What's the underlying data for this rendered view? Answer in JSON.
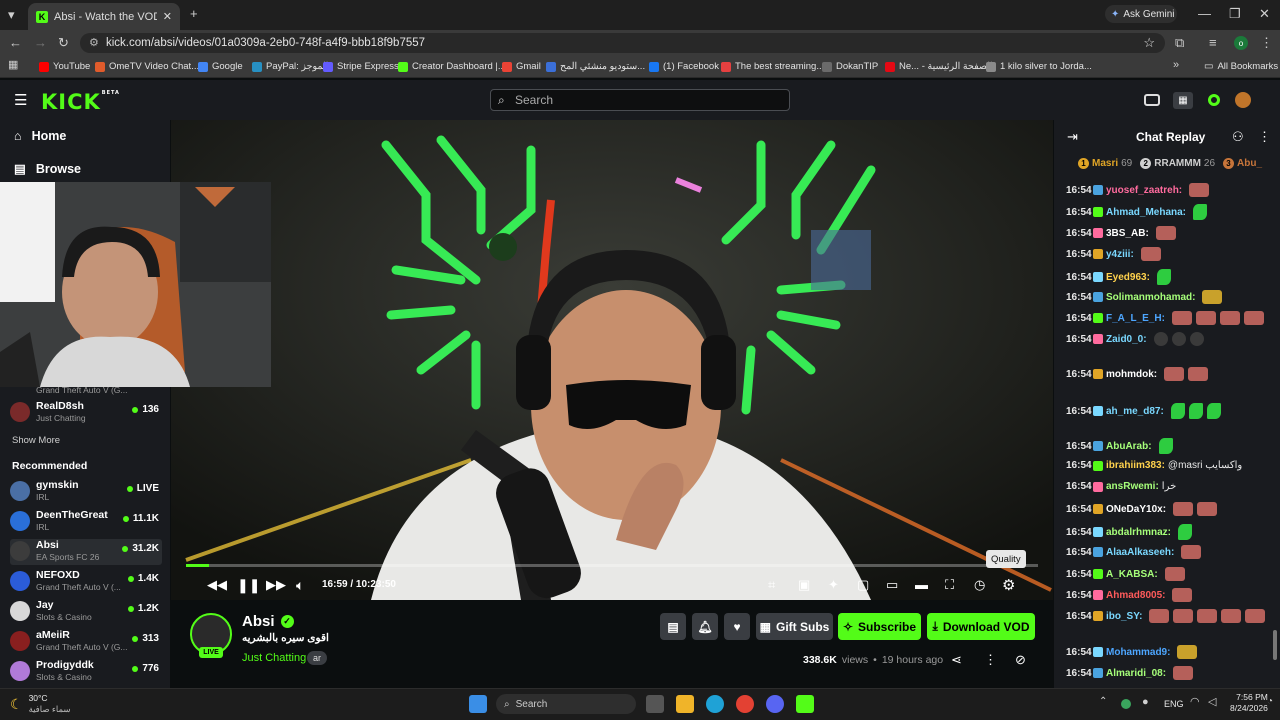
{
  "browser": {
    "tab_title": "Absi - Watch the VOD on K",
    "ask_gemini": "Ask Gemini",
    "url": "kick.com/absi/videos/01a0309a-2eb0-748f-a4f9-bbb18f9b7557",
    "bookmarks": [
      {
        "label": "YouTube",
        "color": "#ff0000"
      },
      {
        "label": "OmeTV Video Chat...",
        "color": "#e05b2b"
      },
      {
        "label": "Google",
        "color": "#4285f4"
      },
      {
        "label": "PayPal: الموجز",
        "color": "#2790c3"
      },
      {
        "label": "Stripe Express",
        "color": "#635bff"
      },
      {
        "label": "Creator Dashboard |...",
        "color": "#53fc18"
      },
      {
        "label": "Gmail",
        "color": "#ea4335"
      },
      {
        "label": "ستوديو منشئي المح...",
        "color": "#3b6fd8"
      },
      {
        "label": "(1) Facebook",
        "color": "#1877f2"
      },
      {
        "label": "The best streaming...",
        "color": "#e54040"
      },
      {
        "label": "DokanTIP",
        "color": "#6a6a6a"
      },
      {
        "label": "Ne... - الصفحة الرئيسية",
        "color": "#e50914"
      },
      {
        "label": "1 kilo silver to Jorda...",
        "color": "#8a8a8a"
      }
    ],
    "all_bookmarks": "All Bookmarks"
  },
  "kick": {
    "logo": "KICK",
    "logo_badge": "BETA",
    "search_placeholder": "Search",
    "nav": [
      {
        "label": "Home",
        "icon": "home-icon"
      },
      {
        "label": "Browse",
        "icon": "browse-icon"
      }
    ],
    "followed_partial": {
      "category": "Grand Theft Auto V (G..."
    },
    "followed": [
      {
        "name": "RealD8sh",
        "category": "Just Chatting",
        "viewers": "136",
        "color": "#7a2a2a"
      }
    ],
    "show_more": "Show More",
    "recommended_title": "Recommended",
    "recommended": [
      {
        "name": "gymskin",
        "category": "IRL",
        "viewers": "LIVE",
        "color": "#4a6fa5"
      },
      {
        "name": "DeenTheGreat",
        "category": "IRL",
        "viewers": "11.1K",
        "color": "#2a6fd8"
      },
      {
        "name": "Absi",
        "category": "EA Sports FC 26",
        "viewers": "31.2K",
        "color": "#3c3c3c"
      },
      {
        "name": "NEFOXD",
        "category": "Grand Theft Auto V (...",
        "viewers": "1.4K",
        "color": "#2b5cd8"
      },
      {
        "name": "Jay",
        "category": "Slots & Casino",
        "viewers": "1.2K",
        "color": "#d8d8d8"
      },
      {
        "name": "aMeiiR",
        "category": "Grand Theft Auto V (G...",
        "viewers": "313",
        "color": "#8a1f1f"
      },
      {
        "name": "Prodigyddk",
        "category": "Slots & Casino",
        "viewers": "776",
        "color": "#b07ad8"
      }
    ]
  },
  "player": {
    "time": "16:59 / 10:23:50",
    "progress_fraction": 0.027,
    "tooltip": "Quality"
  },
  "channel": {
    "name": "Absi",
    "live_badge": "LIVE",
    "subtitle": "اقوى سيره بالبشريه",
    "category": "Just Chatting",
    "language": "ar",
    "gift_subs": "Gift Subs",
    "subscribe": "Subscribe",
    "download": "Download VOD",
    "views": "338.6K",
    "views_label": "views",
    "ago": "19 hours ago"
  },
  "chat": {
    "title": "Chat Replay",
    "leaders": [
      {
        "rank": "1",
        "name": "Masri",
        "count": "69"
      },
      {
        "rank": "2",
        "name": "RRAMMM",
        "count": "26"
      },
      {
        "rank": "3",
        "name": "Abu_",
        "count": ""
      }
    ],
    "messages": [
      {
        "time": "16:54",
        "user": "yuosef_zaatreh:",
        "color": "#ff6b9e",
        "text": "",
        "emotes": [
          "r"
        ]
      },
      {
        "time": "16:54",
        "user": "Ahmad_Mehana:",
        "color": "#7ad8ff",
        "text": "",
        "emotes": [
          "g"
        ]
      },
      {
        "time": "16:54",
        "user": "3BS_AB:",
        "color": "#ffffff",
        "text": "",
        "emotes": [
          "r"
        ]
      },
      {
        "time": "16:54",
        "user": "y4ziii:",
        "color": "#7ad8ff",
        "text": "",
        "emotes": [
          "r"
        ]
      },
      {
        "time": "16:54",
        "user": "Eyed963:",
        "color": "#ffd24d",
        "text": "",
        "emotes": [
          "g"
        ]
      },
      {
        "time": "16:54",
        "user": "Solimanmohamad:",
        "color": "#a6ff7a",
        "text": "",
        "emotes": [
          "y"
        ]
      },
      {
        "time": "16:54",
        "user": "F_A_L_E_H:",
        "color": "#4da6ff",
        "text": "",
        "emotes": [
          "r",
          "r",
          "r",
          "r"
        ]
      },
      {
        "time": "16:54",
        "user": "Zaid0_0:",
        "color": "#7ad8ff",
        "text": "",
        "emotes": [
          "d",
          "d",
          "d"
        ]
      },
      {
        "time": "16:54",
        "user": "mohmdok:",
        "color": "#ffffff",
        "text": "",
        "emotes": [
          "r",
          "r"
        ]
      },
      {
        "time": "16:54",
        "user": "ah_me_d87:",
        "color": "#7ad8ff",
        "text": "",
        "emotes": [
          "g",
          "g",
          "g"
        ]
      },
      {
        "time": "16:54",
        "user": "AbuArab:",
        "color": "#a6ff7a",
        "text": "",
        "emotes": [
          "g"
        ]
      },
      {
        "time": "16:54",
        "user": "ibrahiim383:",
        "color": "#ffd24d",
        "text": "@masri واكسايب",
        "emotes": []
      },
      {
        "time": "16:54",
        "user": "ansRwemi:",
        "color": "#a6ff7a",
        "text": "خرا",
        "emotes": []
      },
      {
        "time": "16:54",
        "user": "ONeDaY10x:",
        "color": "#ffffff",
        "text": "",
        "emotes": [
          "r",
          "r"
        ]
      },
      {
        "time": "16:54",
        "user": "abdalrhmnaz:",
        "color": "#a6ff7a",
        "text": "",
        "emotes": [
          "g"
        ]
      },
      {
        "time": "16:54",
        "user": "AlaaAlkaseeh:",
        "color": "#7ad8ff",
        "text": "",
        "emotes": [
          "r"
        ]
      },
      {
        "time": "16:54",
        "user": "A_KABSA:",
        "color": "#a6ff7a",
        "text": "",
        "emotes": [
          "r"
        ]
      },
      {
        "time": "16:54",
        "user": "Ahmad8005:",
        "color": "#ff5b5b",
        "text": "",
        "emotes": [
          "r"
        ]
      },
      {
        "time": "16:54",
        "user": "ibo_SY:",
        "color": "#7ad8ff",
        "text": "",
        "emotes": [
          "r",
          "r",
          "r",
          "r",
          "r"
        ]
      },
      {
        "time": "16:54",
        "user": "Mohammad9:",
        "color": "#4da6ff",
        "text": "",
        "emotes": [
          "y"
        ]
      },
      {
        "time": "16:54",
        "user": "Almaridi_08:",
        "color": "#a6ff7a",
        "text": "",
        "emotes": [
          "r"
        ]
      }
    ]
  },
  "taskbar": {
    "weather_temp": "30°C",
    "weather_desc": "سماء صافية",
    "search": "Search",
    "lang": "ENG",
    "time": "7:56 PM",
    "date": "8/24/2026"
  }
}
